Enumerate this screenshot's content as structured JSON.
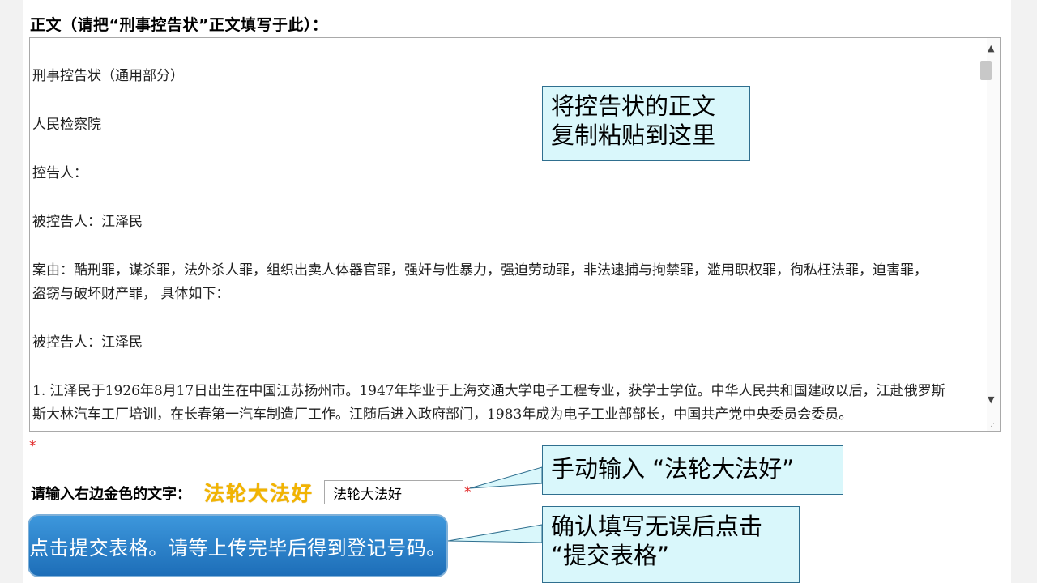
{
  "form": {
    "heading": "正文（请把“刑事控告状”正文填写于此）：",
    "body_paragraphs": [
      "刑事控告状（通用部分）",
      "人民检察院",
      "控告人：",
      "被控告人：江泽民",
      "案由：酷刑罪，谋杀罪，法外杀人罪，组织出卖人体器官罪，强奸与性暴力，强迫劳动罪，非法逮捕与拘禁罪，滥用职权罪，徇私枉法罪，迫害罪，\n盗窃与破坏财产罪， 具体如下：",
      "被控告人：江泽民",
      "1. 江泽民于1926年8月17日出生在中国江苏扬州市。1947年毕业于上海交通大学电子工程专业，获学士学位。中华人民共和国建政以后，江赴俄罗斯\n斯大林汽车工厂培训，在长春第一汽车制造厂工作。江随后进入政府部门，1983年成为电子工业部部长，中国共产党中央委员会委员。"
    ],
    "required_mark": "*",
    "captcha_label": "请输入右边金色的文字：",
    "captcha_image_text": "法轮大法好",
    "captcha_value": "法轮大法好",
    "submit_label": "点击提交表格。请等上传完毕后得到登记号码。"
  },
  "annotations": {
    "paste_note": "将控告状的正文\n复制粘贴到这里",
    "captcha_note": "手动输入 “法轮大法好”",
    "submit_note": "确认填写无误后点击\n  “提交表格”"
  },
  "colors": {
    "note_bg": "#d9f7fb",
    "note_border": "#2f6f8f",
    "captcha_gold": "#f2b400",
    "required_red": "#e02020",
    "button_blue": "#2b82cc"
  },
  "icons": {
    "scroll_up": "▲",
    "scroll_down": "▼",
    "resize_grip": "⋰"
  }
}
